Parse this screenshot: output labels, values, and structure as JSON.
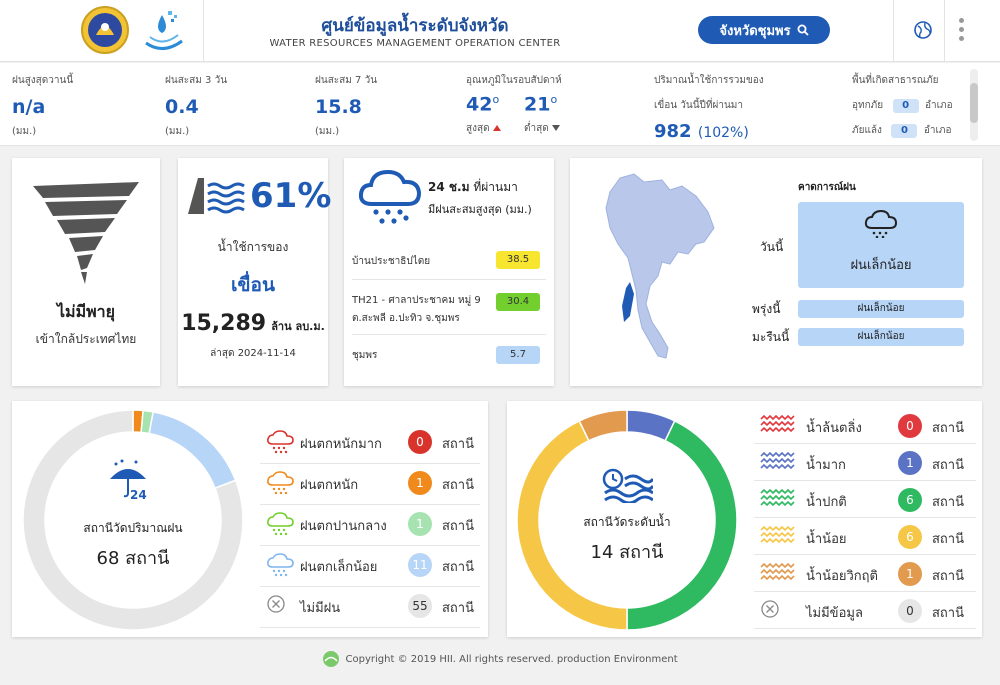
{
  "header": {
    "title_th": "ศูนย์ข้อมูลน้ำระดับจังหวัด",
    "title_en": "WATER RESOURCES MANAGEMENT OPERATION CENTER",
    "province_button": "จังหวัดชุมพร"
  },
  "stats": {
    "max_rain_today": {
      "label": "ฝนสูงสุดวานนี้",
      "value": "n/a",
      "unit": "(มม.)"
    },
    "rain_3day": {
      "label": "ฝนสะสม 3 วัน",
      "value": "0.4",
      "unit": "(มม.)"
    },
    "rain_7day": {
      "label": "ฝนสะสม 7 วัน",
      "value": "15.8",
      "unit": "(มม.)"
    },
    "temperature": {
      "label": "อุณหภูมิในรอบสัปดาห์",
      "max": "42",
      "min": "21",
      "max_label": "สูงสุด",
      "min_label": "ต่ำสุด"
    },
    "dam_storage": {
      "label1": "ปริมาณน้ำใช้การรวมของ",
      "label2": "เขื่อน วันนี้ปีที่ผ่านมา",
      "value": "982",
      "percent": "(102%)"
    },
    "disaster": {
      "label": "พื้นที่เกิดสาธารณภัย",
      "flood_label": "อุทกภัย",
      "flood_value": "0",
      "drought_label": "ภัยแล้ง",
      "drought_value": "0",
      "unit": "อำเภอ"
    }
  },
  "storm_card": {
    "title": "ไม่มีพายุ",
    "subtitle": "เข้าใกล้ประเทศไทย"
  },
  "dam_card": {
    "percent": "61%",
    "label": "น้ำใช้การของ",
    "dam": "เขื่อน",
    "volume": "15,289",
    "volume_unit": "ล้าน ลบ.ม.",
    "updated": "ล่าสุด 2024-11-14"
  },
  "rain24": {
    "title1": "24 ช.ม",
    "title1b": "ที่ผ่านมา",
    "title2": "มีฝนสะสมสูงสุด (มม.)",
    "stations": [
      {
        "name": "บ้านประชาธิปไตย",
        "value": "38.5",
        "color": "#f7e52f"
      },
      {
        "name": "TH21 - ศาลาประชาคม หมู่ 9",
        "name2": "ต.สะพลี อ.ปะทิว จ.ชุมพร",
        "value": "30.4",
        "color": "#72cf2e"
      },
      {
        "name": "ชุมพร",
        "value": "5.7",
        "color": "#b7d5f7"
      }
    ]
  },
  "forecast": {
    "title": "คาดการณ์ฝน",
    "today_label": "วันนี้",
    "today_value": "ฝนเล็กน้อย",
    "tomorrow_label": "พรุ่งนี้",
    "tomorrow_value": "ฝนเล็กน้อย",
    "dayafter_label": "มะรืนนี้",
    "dayafter_value": "ฝนเล็กน้อย"
  },
  "rain_stations": {
    "center_label": "สถานีวัดปริมาณฝน",
    "total": "68 สถานี",
    "unit": "สถานี",
    "items": [
      {
        "label": "ฝนตกหนักมาก",
        "count": "0",
        "color": "#d9342b"
      },
      {
        "label": "ฝนตกหนัก",
        "count": "1",
        "color": "#f08a1c"
      },
      {
        "label": "ฝนตกปานกลาง",
        "count": "1",
        "color": "#a6e3b0"
      },
      {
        "label": "ฝนตกเล็กน้อย",
        "count": "11",
        "color": "#b7d5f7"
      },
      {
        "label": "ไม่มีฝน",
        "count": "55",
        "color": "#e6e6e6"
      }
    ]
  },
  "water_stations": {
    "center_label": "สถานีวัดระดับน้ำ",
    "total": "14 สถานี",
    "unit": "สถานี",
    "items": [
      {
        "label": "น้ำล้นตลิ่ง",
        "count": "0",
        "color": "#e0393e"
      },
      {
        "label": "น้ำมาก",
        "count": "1",
        "color": "#5b73c4"
      },
      {
        "label": "น้ำปกติ",
        "count": "6",
        "color": "#2fba62"
      },
      {
        "label": "น้ำน้อย",
        "count": "6",
        "color": "#f6c646"
      },
      {
        "label": "น้ำน้อยวิกฤติ",
        "count": "1",
        "color": "#e19a4e"
      },
      {
        "label": "ไม่มีข้อมูล",
        "count": "0",
        "color": "#e6e6e6"
      }
    ]
  },
  "footer": {
    "text": "Copyright © 2019 HII. All rights reserved. production Environment"
  }
}
